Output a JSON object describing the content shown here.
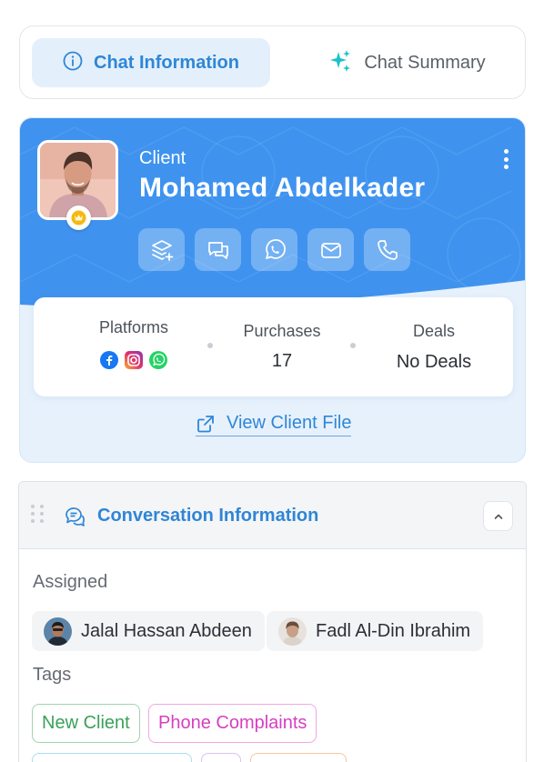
{
  "tabs": {
    "active": {
      "label": "Chat Information",
      "icon": "info-icon"
    },
    "other": {
      "label": "Chat Summary",
      "icon": "sparkles-icon"
    }
  },
  "client": {
    "role": "Client",
    "name": "Mohamed Abdelkader",
    "actions": [
      "layers-add-icon",
      "chat-icon",
      "whatsapp-icon",
      "mail-icon",
      "phone-icon"
    ],
    "stats": {
      "platforms_label": "Platforms",
      "platforms": [
        "facebook-icon",
        "instagram-icon",
        "whatsapp-icon"
      ],
      "purchases_label": "Purchases",
      "purchases_value": "17",
      "deals_label": "Deals",
      "deals_value": "No Deals"
    },
    "view_file": "View Client File"
  },
  "conversation": {
    "title": "Conversation Information",
    "assigned_label": "Assigned",
    "assigned": [
      {
        "name": "Jalal Hassan Abdeen"
      },
      {
        "name": "Fadl Al-Din Ibrahim"
      }
    ],
    "tags_label": "Tags",
    "tags": [
      {
        "label": "New Client",
        "color": "#3aa15a",
        "border": "#9fd6ae"
      },
      {
        "label": "Phone Complaints",
        "color": "#d63fc1",
        "border": "#f0a7e4"
      }
    ]
  },
  "colors": {
    "accent": "#2f86d6",
    "hero": "#3f93ef"
  }
}
